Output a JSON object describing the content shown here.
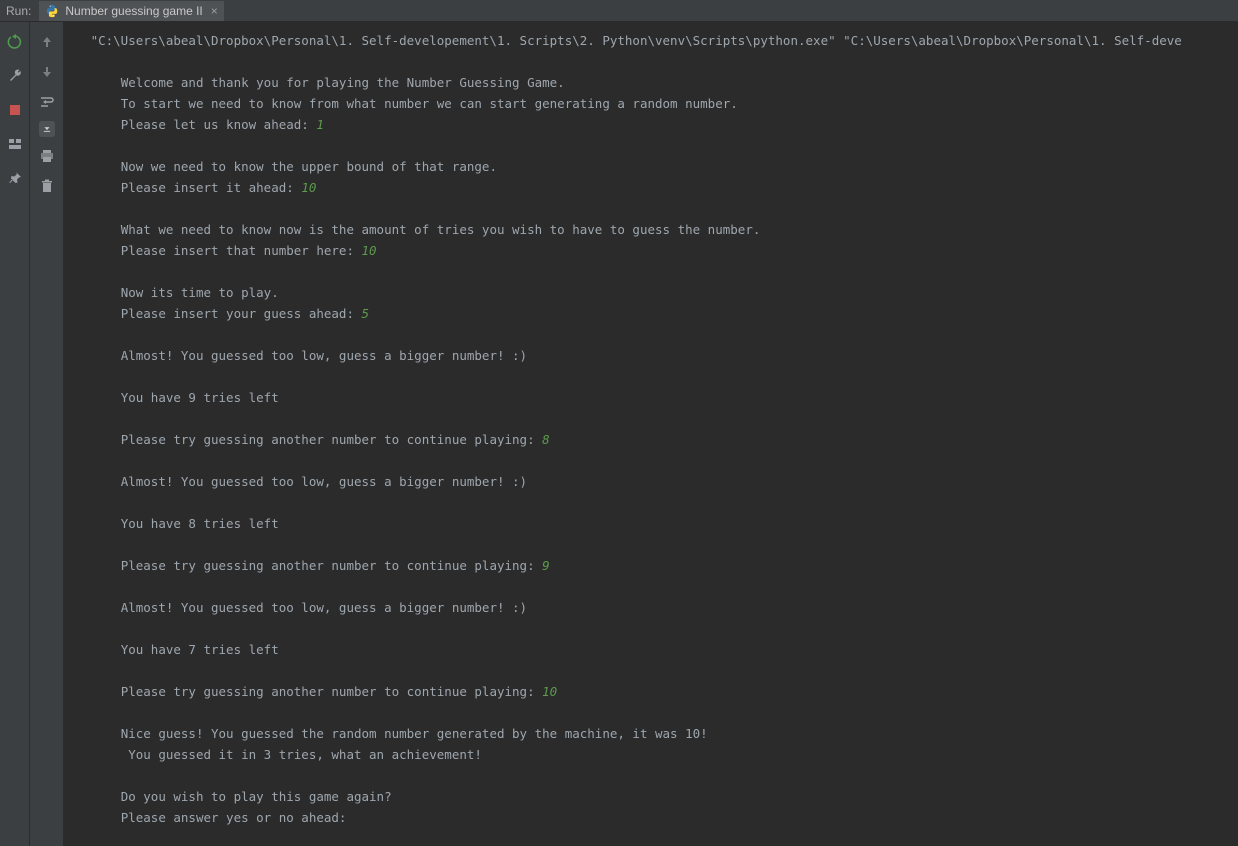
{
  "tabstrip": {
    "run_label": "Run:",
    "tab_name": "Number guessing game II"
  },
  "gutter": {
    "rerun": "rerun-icon",
    "wrench": "wrench-icon",
    "stop": "stop-icon",
    "layout": "layout-icon",
    "pin": "pin-icon"
  },
  "gutter2": {
    "up": "arrow-up-icon",
    "down": "arrow-down-icon",
    "wrap": "wrap-icon",
    "scroll": "scroll-end-icon",
    "print": "print-icon",
    "trash": "trash-icon"
  },
  "console": {
    "indent0": "   ",
    "indent1": "       ",
    "lines": [
      {
        "i": 0,
        "t": "\"C:\\Users\\abeal\\Dropbox\\Personal\\1. Self-developement\\1. Scripts\\2. Python\\venv\\Scripts\\python.exe\" \"C:\\Users\\abeal\\Dropbox\\Personal\\1. Self-deve"
      },
      {
        "i": 0,
        "t": ""
      },
      {
        "i": 1,
        "t": "Welcome and thank you for playing the Number Guessing Game."
      },
      {
        "i": 1,
        "t": "To start we need to know from what number we can start generating a random number."
      },
      {
        "i": 1,
        "t": "Please let us know ahead: ",
        "v": "1"
      },
      {
        "i": 1,
        "t": ""
      },
      {
        "i": 1,
        "t": "Now we need to know the upper bound of that range."
      },
      {
        "i": 1,
        "t": "Please insert it ahead: ",
        "v": "10"
      },
      {
        "i": 1,
        "t": ""
      },
      {
        "i": 1,
        "t": "What we need to know now is the amount of tries you wish to have to guess the number."
      },
      {
        "i": 1,
        "t": "Please insert that number here: ",
        "v": "10"
      },
      {
        "i": 1,
        "t": ""
      },
      {
        "i": 1,
        "t": "Now its time to play."
      },
      {
        "i": 1,
        "t": "Please insert your guess ahead: ",
        "v": "5"
      },
      {
        "i": 1,
        "t": ""
      },
      {
        "i": 1,
        "t": "Almost! You guessed too low, guess a bigger number! :)"
      },
      {
        "i": 1,
        "t": ""
      },
      {
        "i": 1,
        "t": "You have 9 tries left"
      },
      {
        "i": 1,
        "t": ""
      },
      {
        "i": 1,
        "t": "Please try guessing another number to continue playing: ",
        "v": "8"
      },
      {
        "i": 1,
        "t": ""
      },
      {
        "i": 1,
        "t": "Almost! You guessed too low, guess a bigger number! :)"
      },
      {
        "i": 1,
        "t": ""
      },
      {
        "i": 1,
        "t": "You have 8 tries left"
      },
      {
        "i": 1,
        "t": ""
      },
      {
        "i": 1,
        "t": "Please try guessing another number to continue playing: ",
        "v": "9"
      },
      {
        "i": 1,
        "t": ""
      },
      {
        "i": 1,
        "t": "Almost! You guessed too low, guess a bigger number! :)"
      },
      {
        "i": 1,
        "t": ""
      },
      {
        "i": 1,
        "t": "You have 7 tries left"
      },
      {
        "i": 1,
        "t": ""
      },
      {
        "i": 1,
        "t": "Please try guessing another number to continue playing: ",
        "v": "10"
      },
      {
        "i": 1,
        "t": ""
      },
      {
        "i": 1,
        "t": "Nice guess! You guessed the random number generated by the machine, it was 10!"
      },
      {
        "i": 1,
        "t": " You guessed it in 3 tries, what an achievement!"
      },
      {
        "i": 1,
        "t": ""
      },
      {
        "i": 1,
        "t": "Do you wish to play this game again?"
      },
      {
        "i": 1,
        "t": "Please answer yes or no ahead:"
      }
    ]
  }
}
